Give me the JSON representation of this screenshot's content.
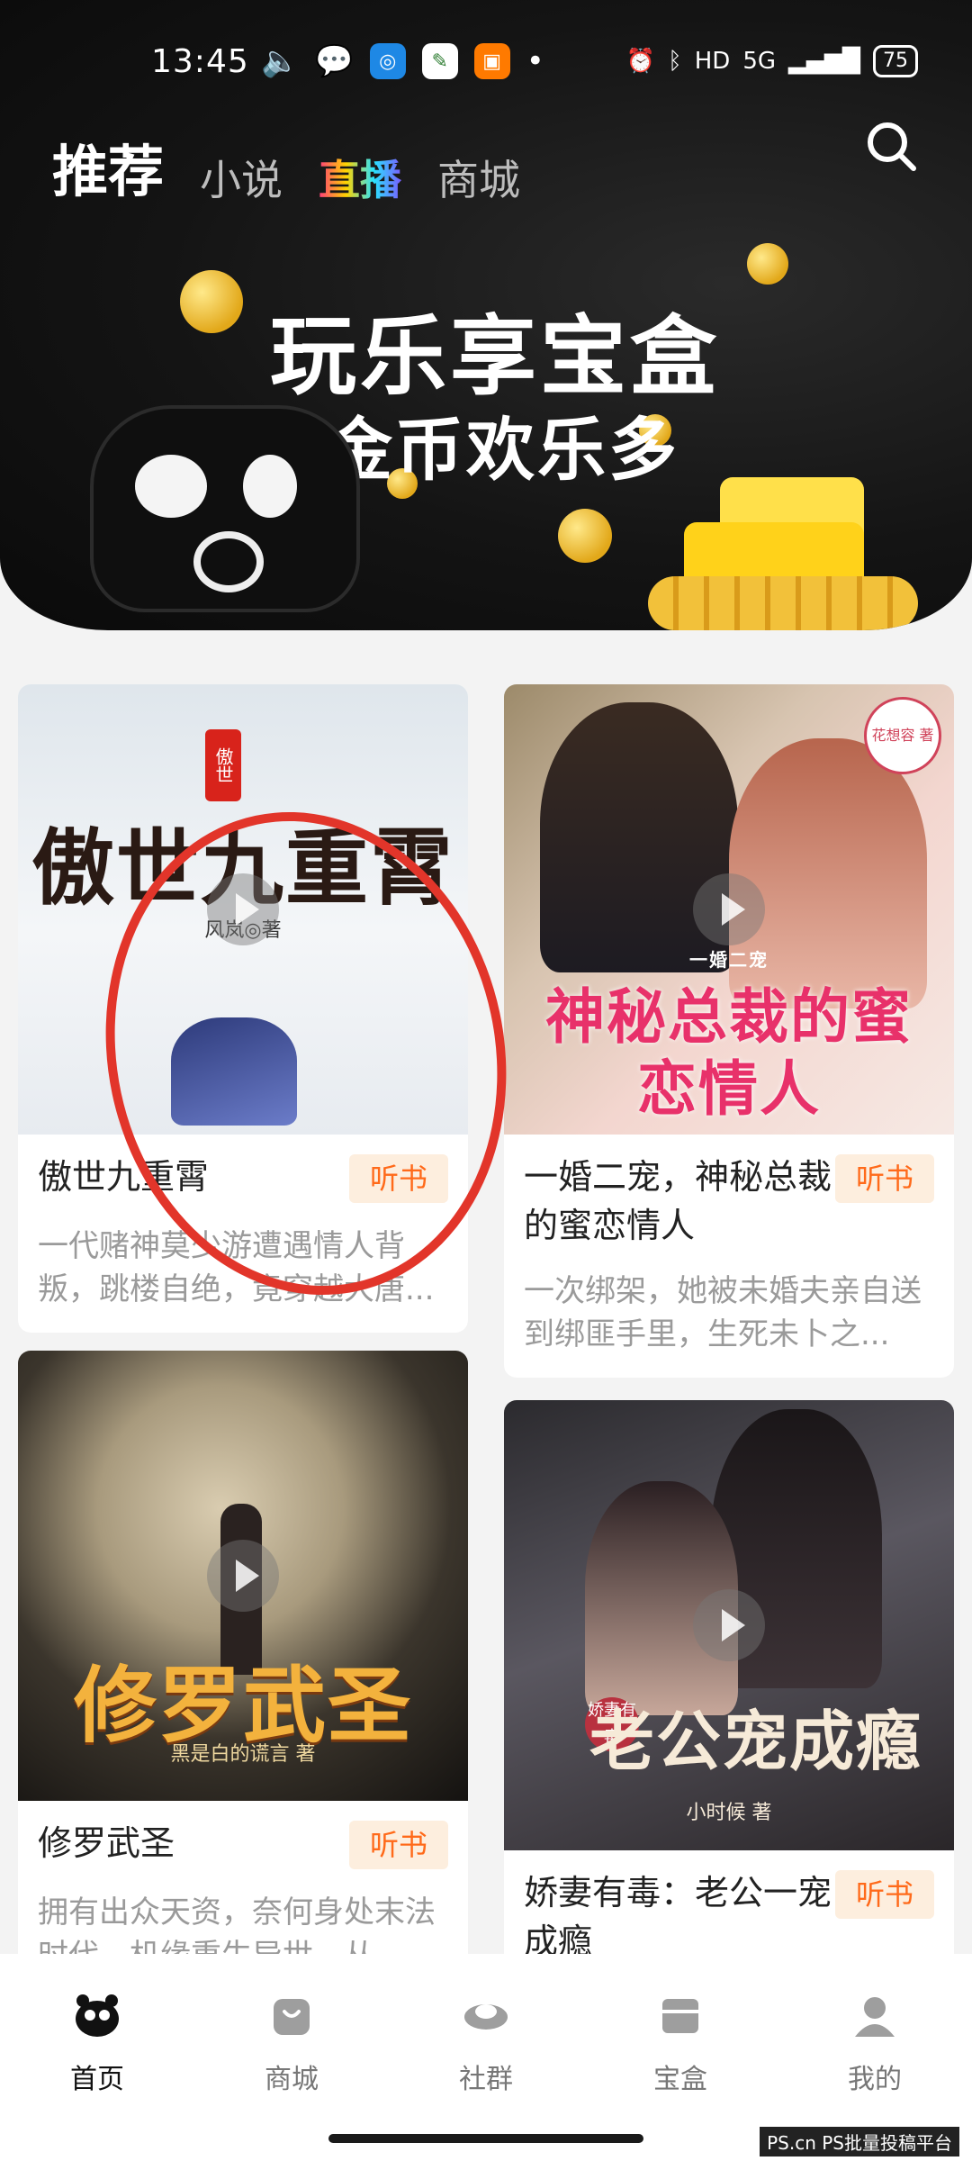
{
  "status_bar": {
    "time": "13:45",
    "network": "5G",
    "hd": "HD",
    "battery": "75"
  },
  "top_tabs": {
    "active": "推荐",
    "items": [
      "小说",
      "直播",
      "商城"
    ]
  },
  "banner": {
    "title": "玩乐享宝盒",
    "subtitle": "金币欢乐多",
    "coin_mark": "乐"
  },
  "feed": {
    "items": [
      {
        "cover_title": "傲世九重霄",
        "cover_author": "风岚◎著",
        "cover_tag": "傲世",
        "title": "傲世九重霄",
        "badge": "听书",
        "desc": "一代赌神莫少游遭遇情人背叛，跳楼自绝，竟穿越大唐..."
      },
      {
        "cover_title": "神秘总裁的蜜恋情人",
        "cover_author": "花想容 著",
        "cover_tag": "一婚二宠",
        "title": "一婚二宠，神秘总裁的蜜恋情人",
        "badge": "听书",
        "desc": "一次绑架，她被未婚夫亲自送到绑匪手里，生死未卜之..."
      },
      {
        "cover_title": "修罗武圣",
        "cover_author": "黑是白的谎言 著",
        "title": "修罗武圣",
        "badge": "听书",
        "desc": "拥有出众天资，奈何身处末法时代，机缘重生异世，从..."
      },
      {
        "cover_title": "老公宠成瘾",
        "cover_author": "小时候 著",
        "cover_tag": "娇妻有毒",
        "title": "娇妻有毒：老公一宠成瘾",
        "badge": "听书",
        "desc": ""
      }
    ]
  },
  "bottom_nav": {
    "items": [
      "首页",
      "商城",
      "社群",
      "宝盒",
      "我的"
    ]
  },
  "watermark": "PS.cn PS批量投稿平台",
  "colors": {
    "badge_text": "#ff6a1a",
    "badge_bg": "#fdeede",
    "annotation": "#e2352a"
  }
}
